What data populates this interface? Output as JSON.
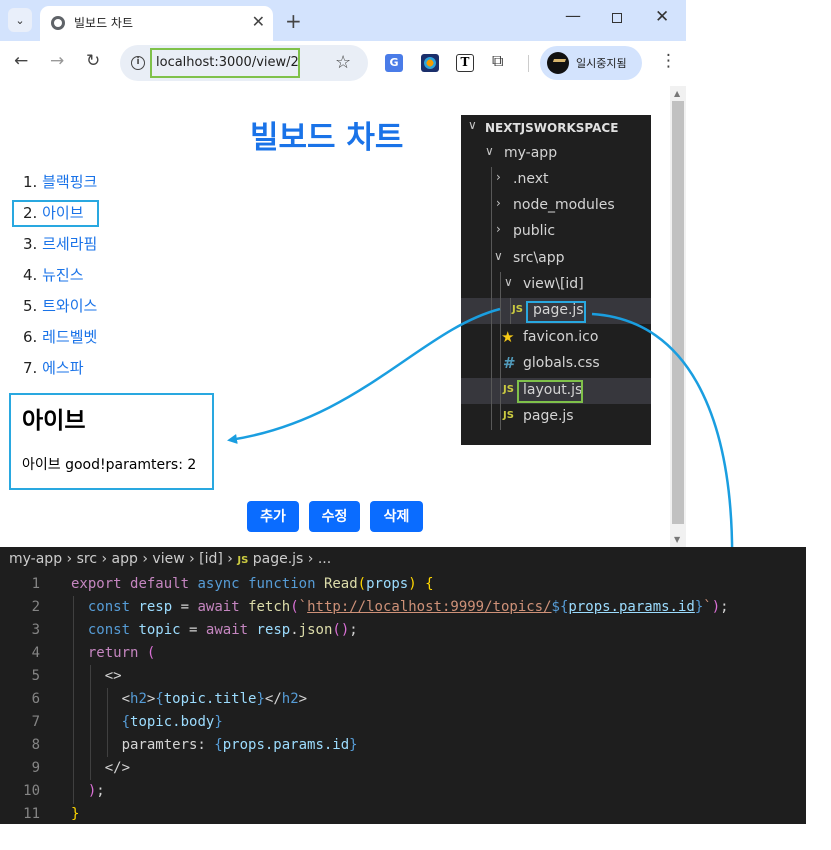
{
  "browser": {
    "tab_title": "빌보드 차트",
    "tab_close": "✕",
    "new_tab": "+",
    "url": "localhost:3000/view/2",
    "profile_label": "일시중지됨",
    "ext_translate": "G",
    "ext_t": "T"
  },
  "page": {
    "title": "빌보드 차트",
    "topics": [
      {
        "num": "1. ",
        "title": "블랙핑크"
      },
      {
        "num": "2. ",
        "title": "아이브"
      },
      {
        "num": "3. ",
        "title": "르세라핌"
      },
      {
        "num": "4. ",
        "title": "뉴진스"
      },
      {
        "num": "5. ",
        "title": "트와이스"
      },
      {
        "num": "6. ",
        "title": "레드벨벳"
      },
      {
        "num": "7. ",
        "title": "에스파"
      }
    ],
    "detail": {
      "title": "아이브",
      "body": "아이브 good!paramters: 2"
    },
    "buttons": {
      "add": "추가",
      "edit": "수정",
      "delete": "삭제"
    }
  },
  "explorer": {
    "root": "NEXTJSWORKSPACE",
    "items": [
      {
        "label": "my-app"
      },
      {
        "label": ".next"
      },
      {
        "label": "node_modules"
      },
      {
        "label": "public"
      },
      {
        "label": "src\\app"
      },
      {
        "label": "view\\[id]"
      },
      {
        "label": "page.js"
      },
      {
        "label": "favicon.ico"
      },
      {
        "label": "globals.css"
      },
      {
        "label": "layout.js"
      },
      {
        "label": "page.js"
      }
    ],
    "js_badge": "JS",
    "hash_badge": "#",
    "colors": {
      "highlight_blue": "#29a8e0",
      "highlight_green": "#7fc14a"
    }
  },
  "editor": {
    "breadcrumb": [
      "my-app",
      "src",
      "app",
      "view",
      "[id]",
      "page.js",
      "..."
    ],
    "line_numbers": [
      "1",
      "2",
      "3",
      "4",
      "5",
      "6",
      "7",
      "8",
      "9",
      "10",
      "11"
    ]
  }
}
